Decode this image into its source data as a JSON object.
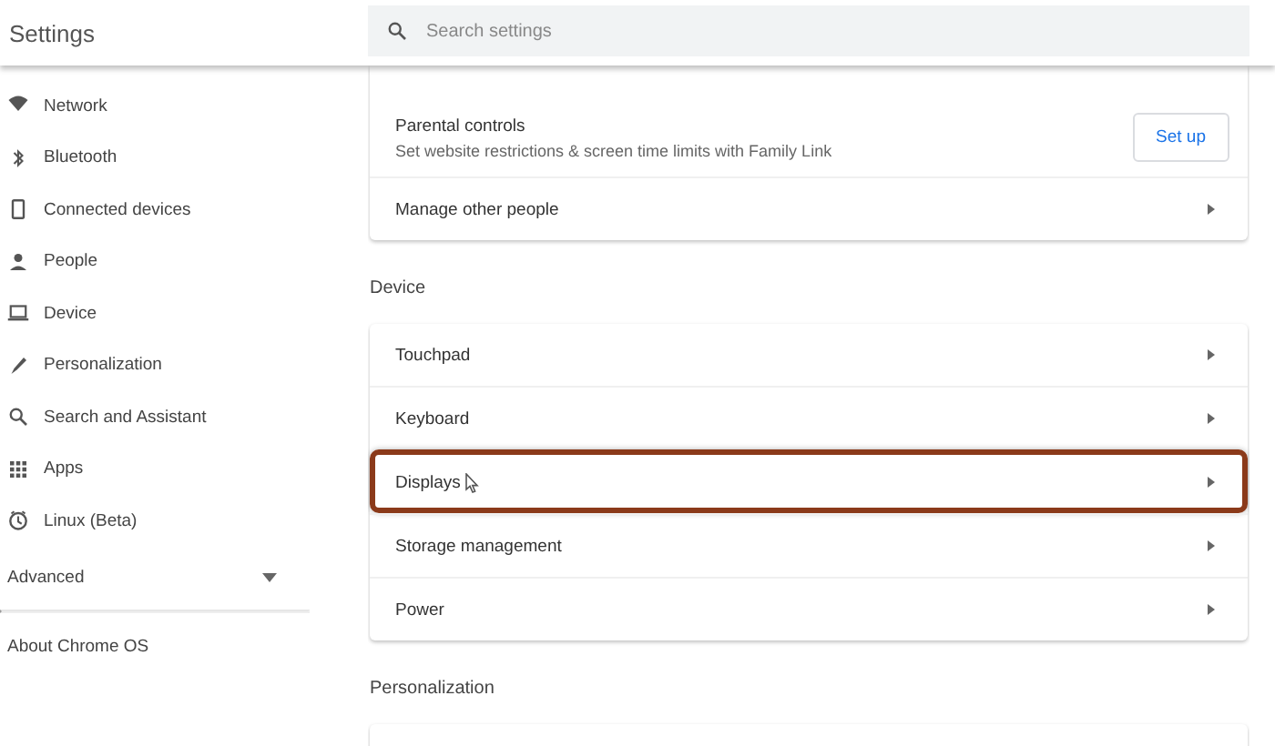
{
  "header": {
    "title": "Settings",
    "search": {
      "placeholder": "Search settings"
    }
  },
  "sidebar": {
    "items": [
      {
        "label": "Network",
        "selected": false
      },
      {
        "label": "Bluetooth",
        "selected": false
      },
      {
        "label": "Connected devices",
        "selected": false
      },
      {
        "label": "People",
        "selected": false
      },
      {
        "label": "Device",
        "selected": false
      },
      {
        "label": "Personalization",
        "selected": false
      },
      {
        "label": "Search and Assistant",
        "selected": false
      },
      {
        "label": "Apps",
        "selected": false
      },
      {
        "label": "Linux (Beta)",
        "selected": false
      }
    ],
    "advanced": {
      "label": "Advanced",
      "expanded": false
    },
    "about": "About Chrome OS"
  },
  "sections": [
    {
      "rows": [
        {
          "kind": "action",
          "label": "Parental controls",
          "sublabel": "Set website restrictions & screen time limits with Family Link",
          "button": "Set up"
        },
        {
          "kind": "link",
          "label": "Manage other people",
          "highlighted": false
        }
      ]
    },
    {
      "heading": "Device",
      "rows": [
        {
          "kind": "link",
          "label": "Touchpad",
          "highlighted": false
        },
        {
          "kind": "link",
          "label": "Keyboard",
          "highlighted": false
        },
        {
          "kind": "link",
          "label": "Displays",
          "highlighted": true
        },
        {
          "kind": "link",
          "label": "Storage management",
          "highlighted": false
        },
        {
          "kind": "link",
          "label": "Power",
          "highlighted": false
        }
      ]
    },
    {
      "heading": "Personalization"
    }
  ]
}
